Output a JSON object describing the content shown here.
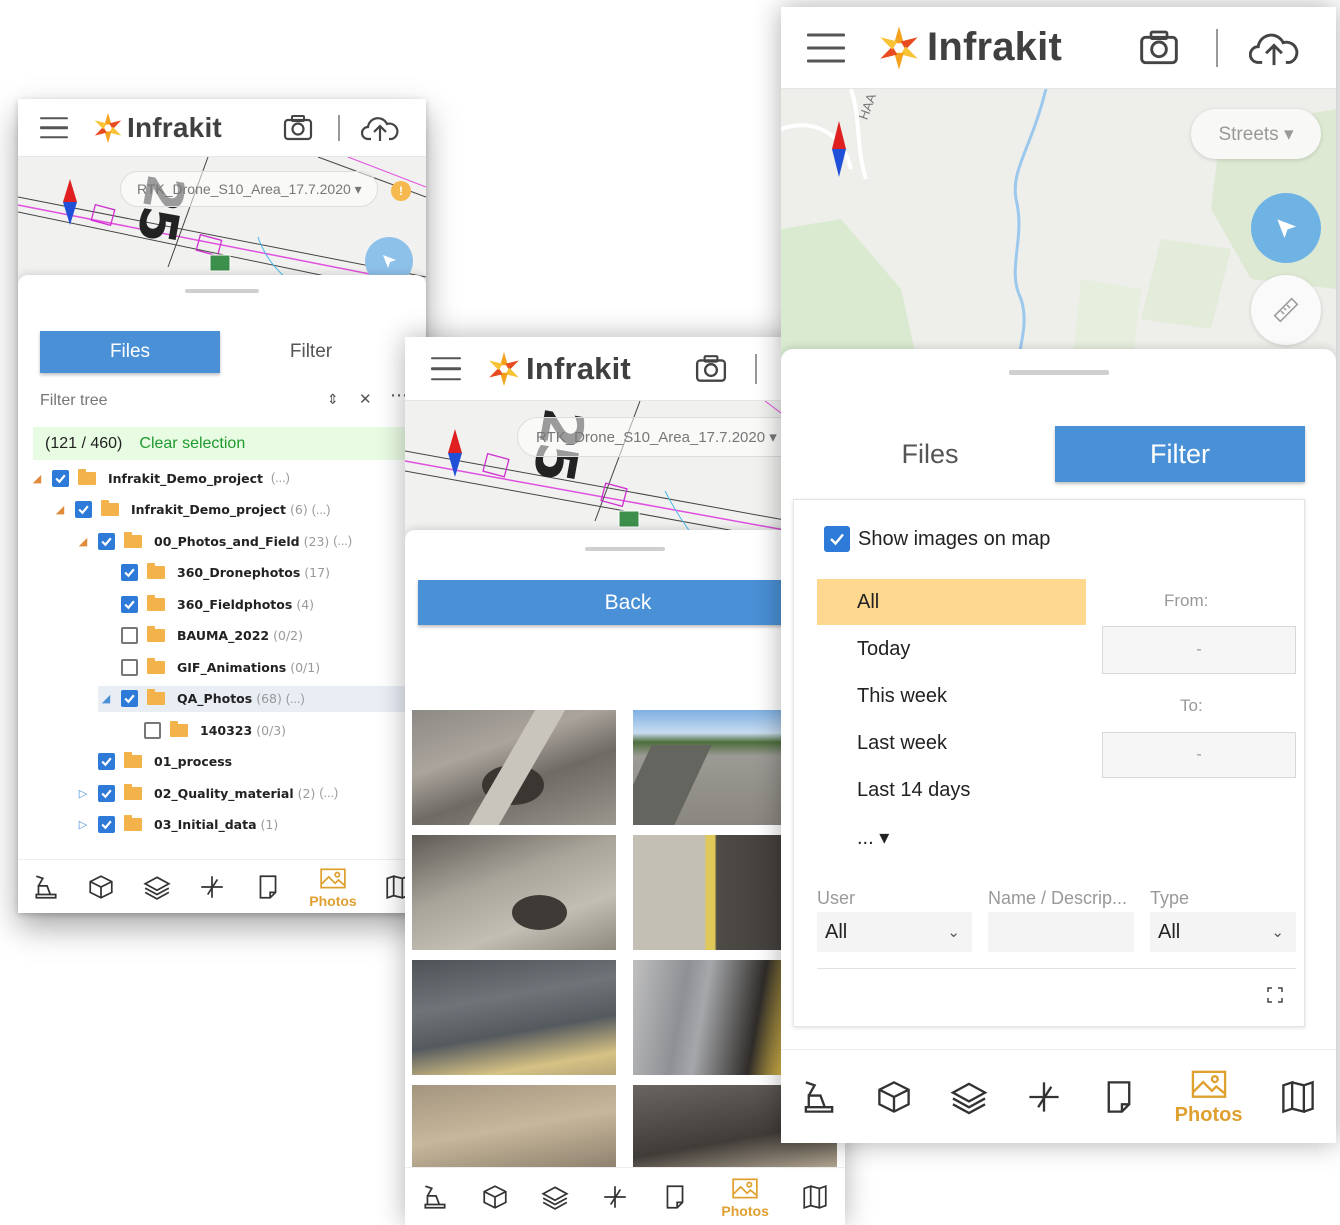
{
  "app": {
    "logo_text": "Infrakit"
  },
  "panel1": {
    "map": {
      "layer_label": "RTK_Drone_S10_Area_17.7.2020 ▾",
      "warning_badge": "!",
      "road_label": "25"
    },
    "tabs": {
      "files": "Files",
      "filter": "Filter"
    },
    "filter_tree_placeholder": "Filter tree",
    "selection": {
      "count": "(121 / 460)",
      "clear": "Clear selection"
    },
    "tree": [
      {
        "name": "Infrakit_Demo_project",
        "count": "",
        "extra": "(...)",
        "checked": true,
        "expander": "open",
        "depth": 0
      },
      {
        "name": "Infrakit_Demo_project",
        "count": "(6)",
        "extra": "(...)",
        "checked": true,
        "expander": "open",
        "depth": 1
      },
      {
        "name": "00_Photos_and_Field",
        "count": "(23)",
        "extra": "(...)",
        "checked": true,
        "expander": "open",
        "depth": 2
      },
      {
        "name": "360_Dronephotos",
        "count": "(17)",
        "extra": "",
        "checked": true,
        "expander": "none",
        "depth": 3
      },
      {
        "name": "360_Fieldphotos",
        "count": "(4)",
        "extra": "",
        "checked": true,
        "expander": "none",
        "depth": 3
      },
      {
        "name": "BAUMA_2022",
        "count": "(0/2)",
        "extra": "",
        "checked": false,
        "expander": "none",
        "depth": 3
      },
      {
        "name": "GIF_Animations",
        "count": "(0/1)",
        "extra": "",
        "checked": false,
        "expander": "none",
        "depth": 3
      },
      {
        "name": "QA_Photos",
        "count": "(68)",
        "extra": "(...)",
        "checked": true,
        "expander": "open-blue",
        "depth": 3,
        "highlight": true
      },
      {
        "name": "140323",
        "count": "(0/3)",
        "extra": "",
        "checked": false,
        "expander": "none",
        "depth": 4
      },
      {
        "name": "01_process",
        "count": "",
        "extra": "",
        "checked": true,
        "expander": "none",
        "depth": 2
      },
      {
        "name": "02_Quality_material",
        "count": "(2)",
        "extra": "(...)",
        "checked": true,
        "expander": "closed",
        "depth": 2
      },
      {
        "name": "03_Initial_data",
        "count": "(1)",
        "extra": "",
        "checked": true,
        "expander": "closed",
        "depth": 2
      }
    ]
  },
  "panel2": {
    "map": {
      "layer_label": "RTK_Drone_S10_Area_17.7.2020 ▾",
      "road_label": "25"
    },
    "back_label": "Back"
  },
  "panel3": {
    "map": {
      "style_label": "Streets ▾",
      "road_label": "HAA"
    },
    "tabs": {
      "files": "Files",
      "filter": "Filter"
    },
    "show_images_label": "Show images on map",
    "periods": [
      "All",
      "Today",
      "This week",
      "Last week",
      "Last 14 days",
      "... ▾"
    ],
    "selected_period": "All",
    "from_label": "From:",
    "from_value": "-",
    "to_label": "To:",
    "to_value": "-",
    "user_label": "User",
    "user_value": "All",
    "name_label": "Name / Descrip...",
    "name_value": "",
    "type_label": "Type",
    "type_value": "All"
  },
  "bottom_nav": {
    "items": [
      "machine-icon",
      "model-cube-icon",
      "layers-icon",
      "measure-icon",
      "document-icon",
      "photos-icon",
      "map-book-icon"
    ],
    "active_label": "Photos"
  },
  "colors": {
    "accent_blue": "#4a90d6",
    "selected_period": "#fed88e",
    "active_nav": "#e0a030",
    "selection_bar": "#e8fbe3",
    "logo_star": [
      "#f4a21d",
      "#e84b1f",
      "#f7c335"
    ]
  }
}
